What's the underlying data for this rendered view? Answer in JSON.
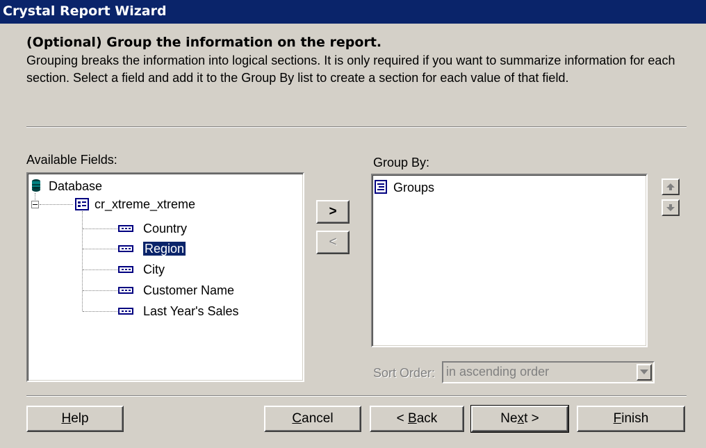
{
  "window": {
    "title": "Crystal Report Wizard"
  },
  "header": {
    "heading": "(Optional) Group the information on the report.",
    "description": "Grouping breaks the information into logical sections. It is only required if you want to summarize information for  each section.  Select a field and add it to the Group By list to create a section for each value of that field."
  },
  "available": {
    "label": "Available Fields:",
    "root": "Database",
    "table": "cr_xtreme_xtreme",
    "fields": [
      "Country",
      "Region",
      "City",
      "Customer Name",
      "Last Year's Sales"
    ],
    "selected_field": "Region"
  },
  "transfer": {
    "add_label": ">",
    "remove_label": "<"
  },
  "group_by": {
    "label": "Group By:",
    "root": "Groups"
  },
  "sort_order": {
    "label": "Sort Order:",
    "value": "in ascending order"
  },
  "buttons": {
    "help": {
      "prefix": "",
      "key": "H",
      "suffix": "elp"
    },
    "cancel": {
      "prefix": "",
      "key": "C",
      "suffix": "ancel"
    },
    "back": {
      "prefix": "< ",
      "key": "B",
      "suffix": "ack"
    },
    "next": {
      "prefix": "Ne",
      "key": "x",
      "suffix": "t >"
    },
    "finish": {
      "prefix": "",
      "key": "F",
      "suffix": "inish"
    }
  },
  "colors": {
    "title_bar": "#0a246a",
    "face": "#d4d0c8",
    "selection": "#0a246a"
  }
}
